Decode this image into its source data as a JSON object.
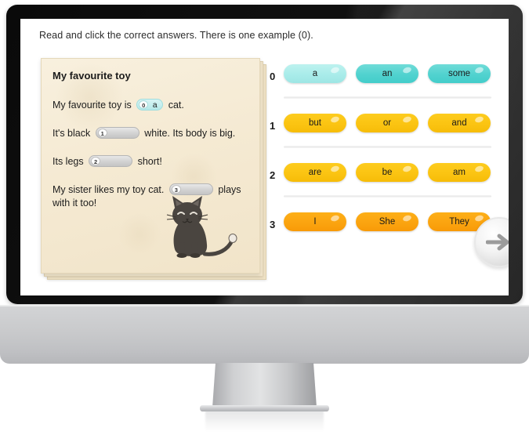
{
  "instruction": "Read and click the correct answers. There is one example (0).",
  "card": {
    "title": "My favourite toy",
    "lines": [
      {
        "pre": "My favourite toy is",
        "blank": {
          "num": "0",
          "value": "a",
          "filled": true
        },
        "post": "cat."
      },
      {
        "pre": "It's black",
        "blank": {
          "num": "1",
          "value": "",
          "filled": false
        },
        "post": "white. Its body is big."
      },
      {
        "pre": "Its legs",
        "blank": {
          "num": "2",
          "value": "",
          "filled": false
        },
        "post": "short!"
      },
      {
        "pre": "My sister likes my toy cat.",
        "blank": {
          "num": "3",
          "value": "",
          "filled": false
        },
        "post": "plays with it too!"
      }
    ],
    "illustration": "black-cat-illustration"
  },
  "answers": {
    "rows": [
      {
        "num": "0",
        "style": "teal",
        "options": [
          {
            "label": "a",
            "state": "selected"
          },
          {
            "label": "an",
            "state": "default"
          },
          {
            "label": "some",
            "state": "default"
          }
        ]
      },
      {
        "num": "1",
        "style": "yellow",
        "options": [
          {
            "label": "but",
            "state": "default"
          },
          {
            "label": "or",
            "state": "default"
          },
          {
            "label": "and",
            "state": "default"
          }
        ]
      },
      {
        "num": "2",
        "style": "yellow",
        "options": [
          {
            "label": "are",
            "state": "default"
          },
          {
            "label": "be",
            "state": "default"
          },
          {
            "label": "am",
            "state": "default"
          }
        ]
      },
      {
        "num": "3",
        "style": "orange",
        "options": [
          {
            "label": "I",
            "state": "default"
          },
          {
            "label": "She",
            "state": "default"
          },
          {
            "label": "They",
            "state": "default"
          }
        ]
      }
    ]
  },
  "next_button": {
    "icon": "arrow-right-icon"
  },
  "colors": {
    "teal_light": "#a9ecea",
    "teal": "#51d2cf",
    "yellow": "#fbc412",
    "orange": "#fba410",
    "paper": "#f5ead3",
    "bezel": "#111111",
    "chin": "#c9cacc",
    "text": "#1c1c1c"
  }
}
